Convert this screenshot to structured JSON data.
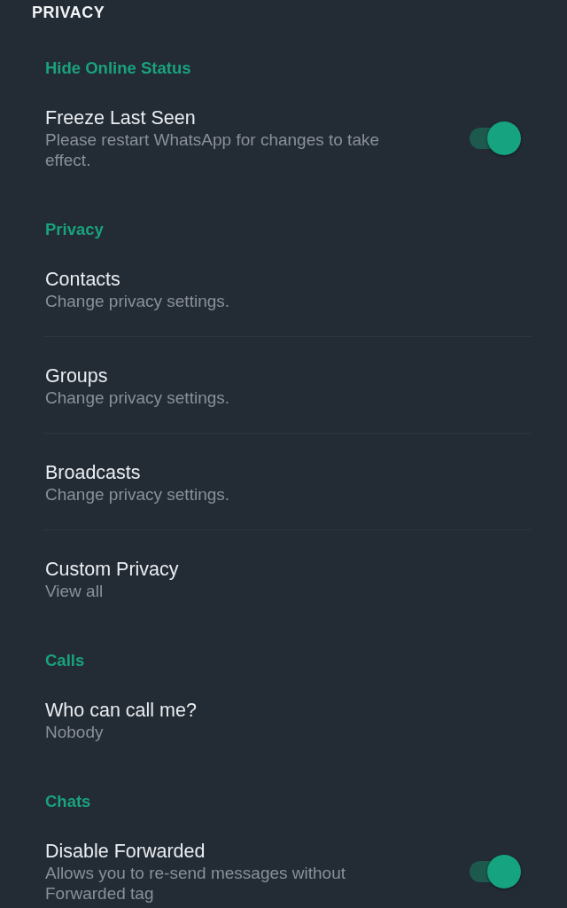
{
  "header": {
    "title": "PRIVACY"
  },
  "sections": [
    {
      "label": "Hide Online Status",
      "items": [
        {
          "kind": "toggle",
          "title": "Freeze Last Seen",
          "subtitle": "Please restart WhatsApp for changes to take effect.",
          "on": true
        }
      ]
    },
    {
      "label": "Privacy",
      "items": [
        {
          "kind": "link",
          "title": "Contacts",
          "subtitle": "Change privacy settings."
        },
        {
          "kind": "link",
          "title": "Groups",
          "subtitle": "Change privacy settings."
        },
        {
          "kind": "link",
          "title": "Broadcasts",
          "subtitle": "Change privacy settings."
        },
        {
          "kind": "link",
          "title": "Custom Privacy",
          "subtitle": "View all"
        }
      ]
    },
    {
      "label": "Calls",
      "items": [
        {
          "kind": "link",
          "title": "Who can call me?",
          "subtitle": "Nobody"
        }
      ]
    },
    {
      "label": "Chats",
      "items": [
        {
          "kind": "toggle",
          "title": "Disable Forwarded",
          "subtitle": "Allows you to re-send messages without Forwarded tag",
          "on": true
        }
      ]
    }
  ]
}
